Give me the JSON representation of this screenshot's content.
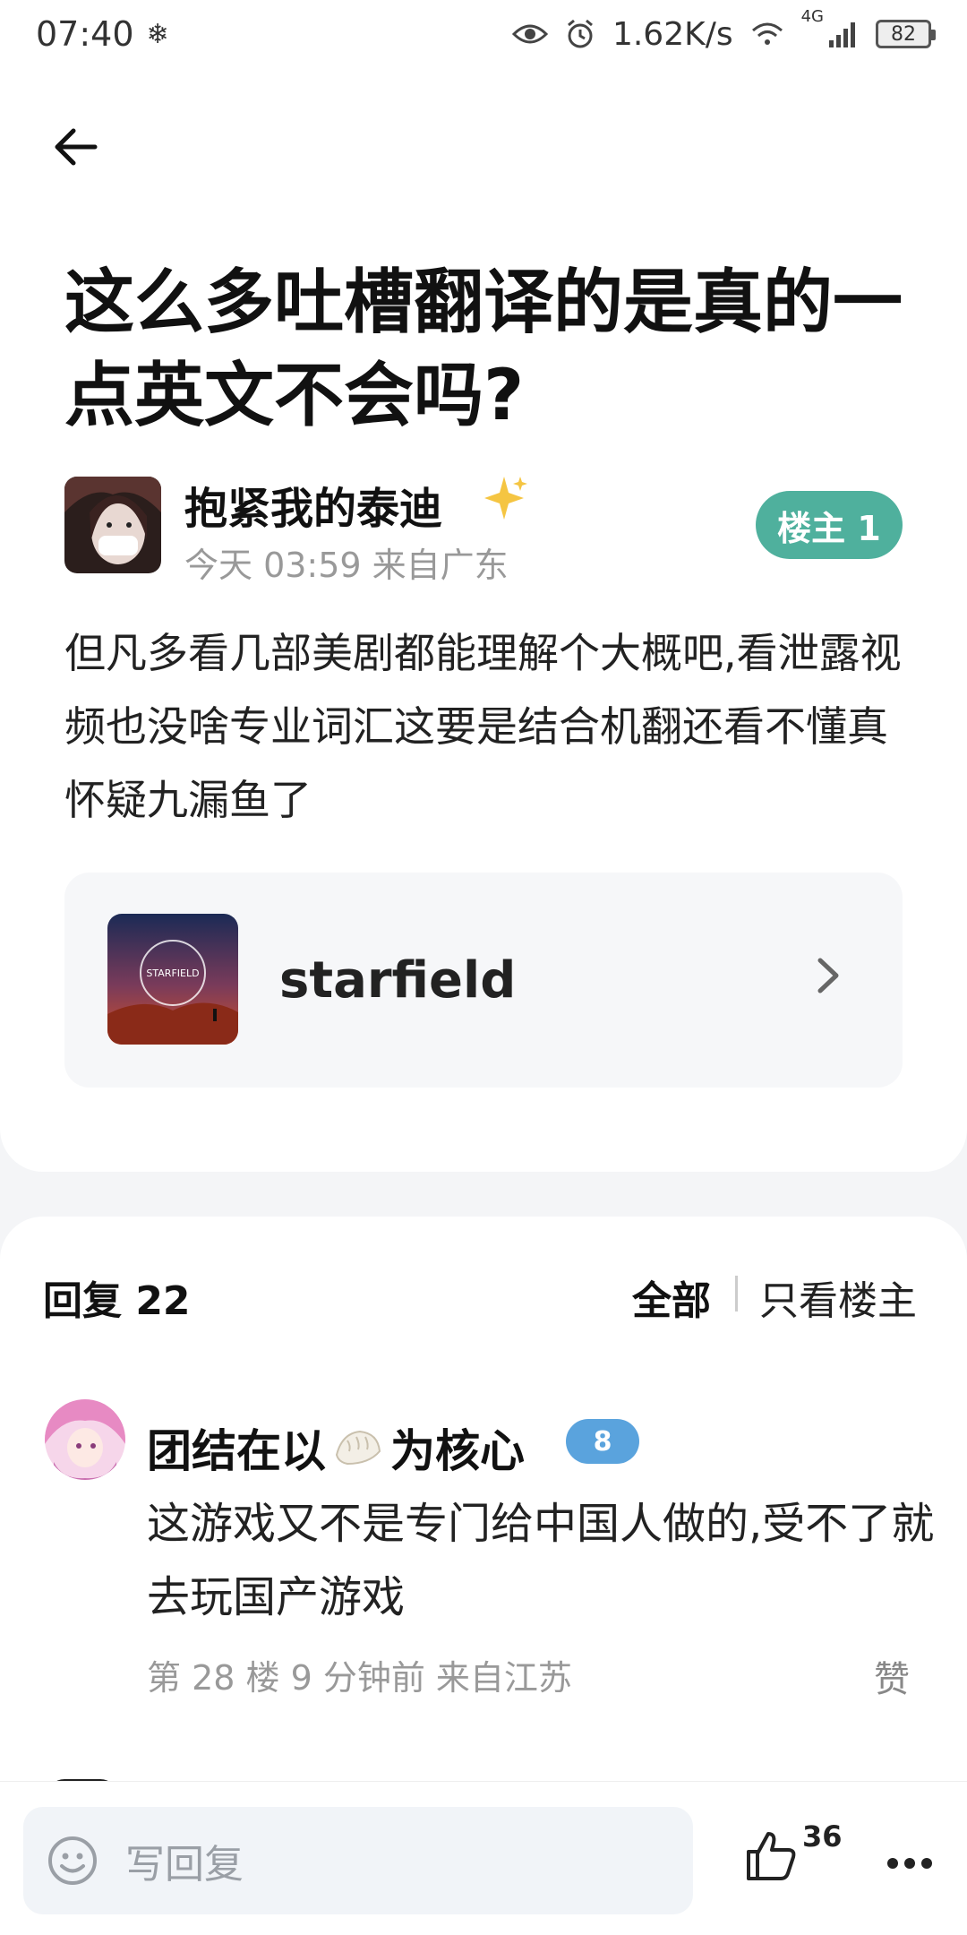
{
  "status_bar": {
    "time": "07:40",
    "net_speed": "1.62K/s",
    "signal_label": "4G",
    "battery": "82"
  },
  "post": {
    "title": "这么多吐槽翻译的是真的一点英文不会吗?",
    "author": "抱紧我的泰迪",
    "meta": "今天 03:59 来自广东",
    "op_badge": "楼主 1",
    "body": "但凡多看几部美剧都能理解个大概吧,看泄露视频也没啥专业词汇这要是结合机翻还看不懂真怀疑九漏鱼了",
    "game_card": {
      "name": "starfield",
      "thumb_text": "STARFIELD"
    }
  },
  "replies": {
    "count_label": "回复 22",
    "filter_all": "全部",
    "filter_op": "只看楼主",
    "items": [
      {
        "user_prefix": "团结在以",
        "user_suffix": "为核心",
        "level": "8",
        "text": "这游戏又不是专门给中国人做的,受不了就去玩国产游戏",
        "meta": "第 28 楼 9 分钟前 来自江苏",
        "like_label": "赞"
      }
    ]
  },
  "bottom_bar": {
    "placeholder": "写回复",
    "like_count": "36"
  },
  "colors": {
    "op_badge": "#4fb09d",
    "level_badge": "#5aa3dd",
    "card_bg": "#f6f7f9",
    "page_bg": "#f4f5f7"
  },
  "icons": [
    "back-arrow-icon",
    "sparkle-icon",
    "chevron-right-icon",
    "eye-icon",
    "alarm-icon",
    "wifi-icon",
    "signal-icon",
    "battery-icon",
    "emoji-icon",
    "thumbs-up-icon",
    "more-dots-icon",
    "dumpling-icon"
  ]
}
